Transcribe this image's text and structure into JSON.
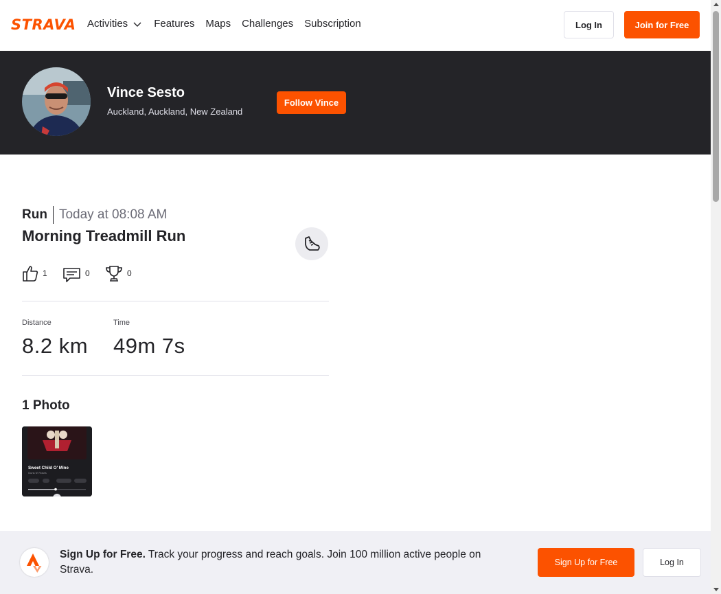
{
  "colors": {
    "brand": "#fc5200",
    "header_dark": "#242428",
    "footer_bg": "#f0f0f5"
  },
  "nav": {
    "logo_text": "STRAVA",
    "links": [
      {
        "label": "Activities",
        "has_dropdown": true
      },
      {
        "label": "Features"
      },
      {
        "label": "Maps"
      },
      {
        "label": "Challenges"
      },
      {
        "label": "Subscription"
      }
    ],
    "login_label": "Log In",
    "join_label": "Join for Free"
  },
  "athlete": {
    "name": "Vince Sesto",
    "location": "Auckland, Auckland, New Zealand",
    "follow_label": "Follow Vince"
  },
  "activity": {
    "type": "Run",
    "date": "Today at 08:08 AM",
    "title": "Morning Treadmill Run",
    "sport_icon": "running-shoe-icon",
    "kudos_count": "1",
    "comments_count": "0",
    "achievements_count": "0",
    "stats": [
      {
        "label": "Distance",
        "value": "8.2 km"
      },
      {
        "label": "Time",
        "value": "49m 7s"
      }
    ]
  },
  "photos": {
    "title": "1 Photo",
    "thumb": {
      "song_title": "Sweet Child O' Mine",
      "artist": "Guns N' Roses"
    }
  },
  "signup": {
    "bold_text": "Sign Up for Free.",
    "text": " Track your progress and reach goals. Join 100 million active people on Strava.",
    "signup_label": "Sign Up for Free",
    "login_label": "Log In"
  }
}
